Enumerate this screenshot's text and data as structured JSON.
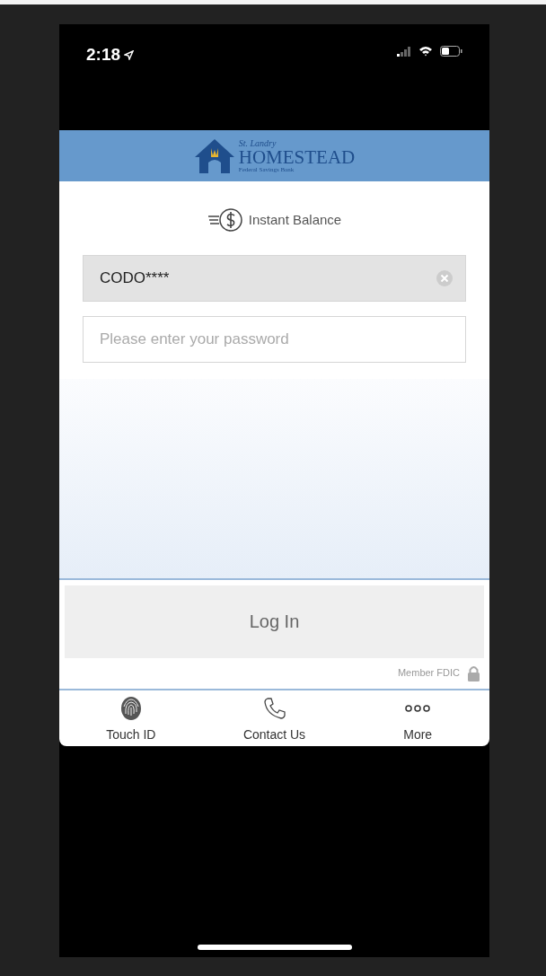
{
  "status_bar": {
    "time": "2:18"
  },
  "header": {
    "logo_top": "St. Landry",
    "logo_main": "HOMESTEAD",
    "logo_bottom": "Federal Savings Bank"
  },
  "instant_balance": {
    "label": "Instant Balance"
  },
  "username": {
    "value": "CODO****"
  },
  "password": {
    "placeholder": "Please enter your password"
  },
  "login_button": {
    "label": "Log In"
  },
  "footer_note": "Member FDIC",
  "tab_bar": [
    {
      "kind": "fingerprint",
      "label": "Touch ID"
    },
    {
      "kind": "phone",
      "label": "Contact Us"
    },
    {
      "kind": "more",
      "label": "More"
    }
  ]
}
